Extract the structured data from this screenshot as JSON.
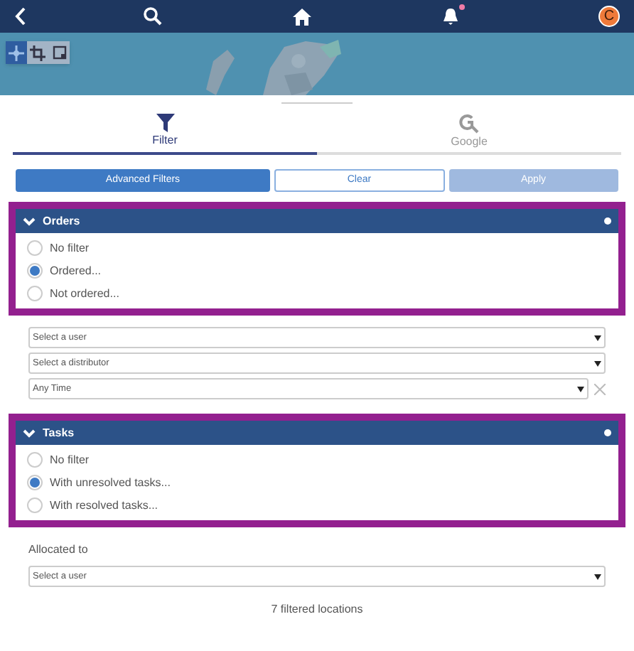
{
  "top_bar": {
    "avatar": "C",
    "notification_unread": true
  },
  "map_tools": [
    {
      "kind": "move",
      "selected": true
    },
    {
      "kind": "crop",
      "selected": false
    },
    {
      "kind": "frame",
      "selected": false
    }
  ],
  "tabs": [
    {
      "label": "Filter",
      "kind": "filter",
      "selected": true
    },
    {
      "label": "Google",
      "kind": "google",
      "selected": false
    }
  ],
  "actions": [
    {
      "label": "Advanced Filters",
      "kind": "primary",
      "disabled": false
    },
    {
      "label": "Clear",
      "kind": "outline",
      "disabled": false
    },
    {
      "label": "Apply",
      "kind": "primary",
      "disabled": true
    }
  ],
  "orders": {
    "title": "Orders",
    "expanded": true,
    "highlighted": true,
    "options": [
      {
        "label": "No filter",
        "selected": false
      },
      {
        "label": "Ordered...",
        "selected": true
      },
      {
        "label": "Not ordered...",
        "selected": false
      }
    ],
    "selects": [
      {
        "value": "Select a user",
        "clearable": false
      },
      {
        "value": "Select a distributor",
        "clearable": false
      },
      {
        "value": "Any Time",
        "clearable": true
      }
    ]
  },
  "tasks": {
    "title": "Tasks",
    "expanded": true,
    "highlighted": true,
    "options": [
      {
        "label": "No filter",
        "selected": false
      },
      {
        "label": "With unresolved tasks...",
        "selected": true
      },
      {
        "label": "With resolved tasks...",
        "selected": false
      }
    ],
    "allocated_label": "Allocated to",
    "selects": [
      {
        "value": "Select a user",
        "clearable": false
      }
    ]
  },
  "footer": "7 filtered locations"
}
